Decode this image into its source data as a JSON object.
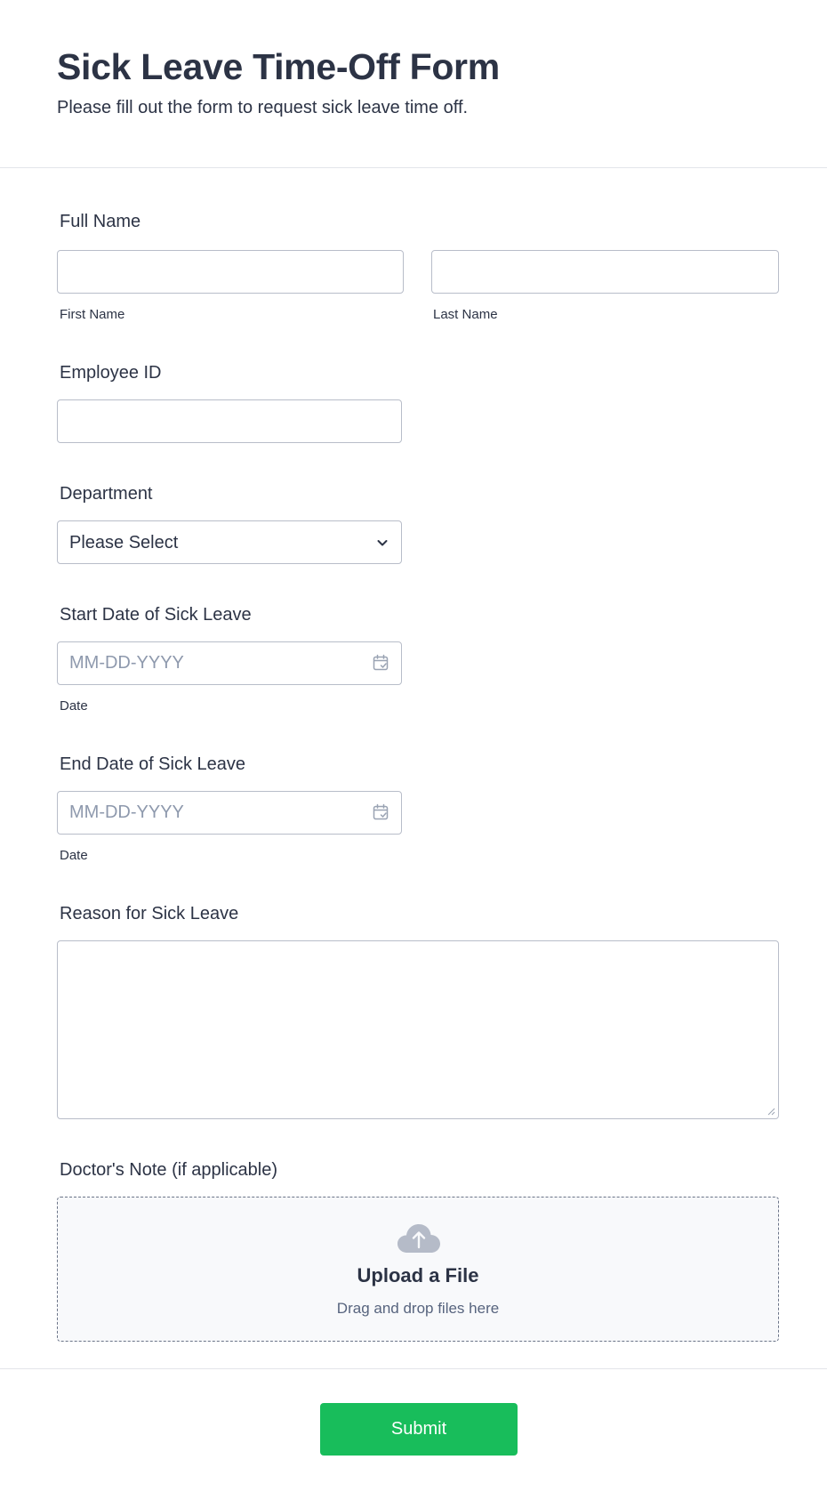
{
  "form": {
    "title": "Sick Leave Time-Off Form",
    "subtitle": "Please fill out the form to request sick leave time off."
  },
  "fields": {
    "full_name": {
      "label": "Full Name",
      "first_name": {
        "value": "",
        "sublabel": "First Name"
      },
      "last_name": {
        "value": "",
        "sublabel": "Last Name"
      }
    },
    "employee_id": {
      "label": "Employee ID",
      "value": ""
    },
    "department": {
      "label": "Department",
      "selected": "Please Select",
      "icon": "chevron-down-icon"
    },
    "start_date": {
      "label": "Start Date of Sick Leave",
      "placeholder": "MM-DD-YYYY",
      "sublabel": "Date",
      "icon": "calendar-icon"
    },
    "end_date": {
      "label": "End Date of Sick Leave",
      "placeholder": "MM-DD-YYYY",
      "sublabel": "Date",
      "icon": "calendar-icon"
    },
    "reason": {
      "label": "Reason for Sick Leave",
      "value": ""
    },
    "doctors_note": {
      "label": "Doctor's Note (if applicable)",
      "upload_title": "Upload a File",
      "upload_subtitle": "Drag and drop files here",
      "icon": "cloud-upload-icon"
    }
  },
  "submit": {
    "label": "Submit",
    "color": "#18bd5b"
  },
  "colors": {
    "text": "#2c3345",
    "border": "#b8bdc9",
    "placeholder": "#8e99ad",
    "upload_bg": "#f8f9fb"
  }
}
